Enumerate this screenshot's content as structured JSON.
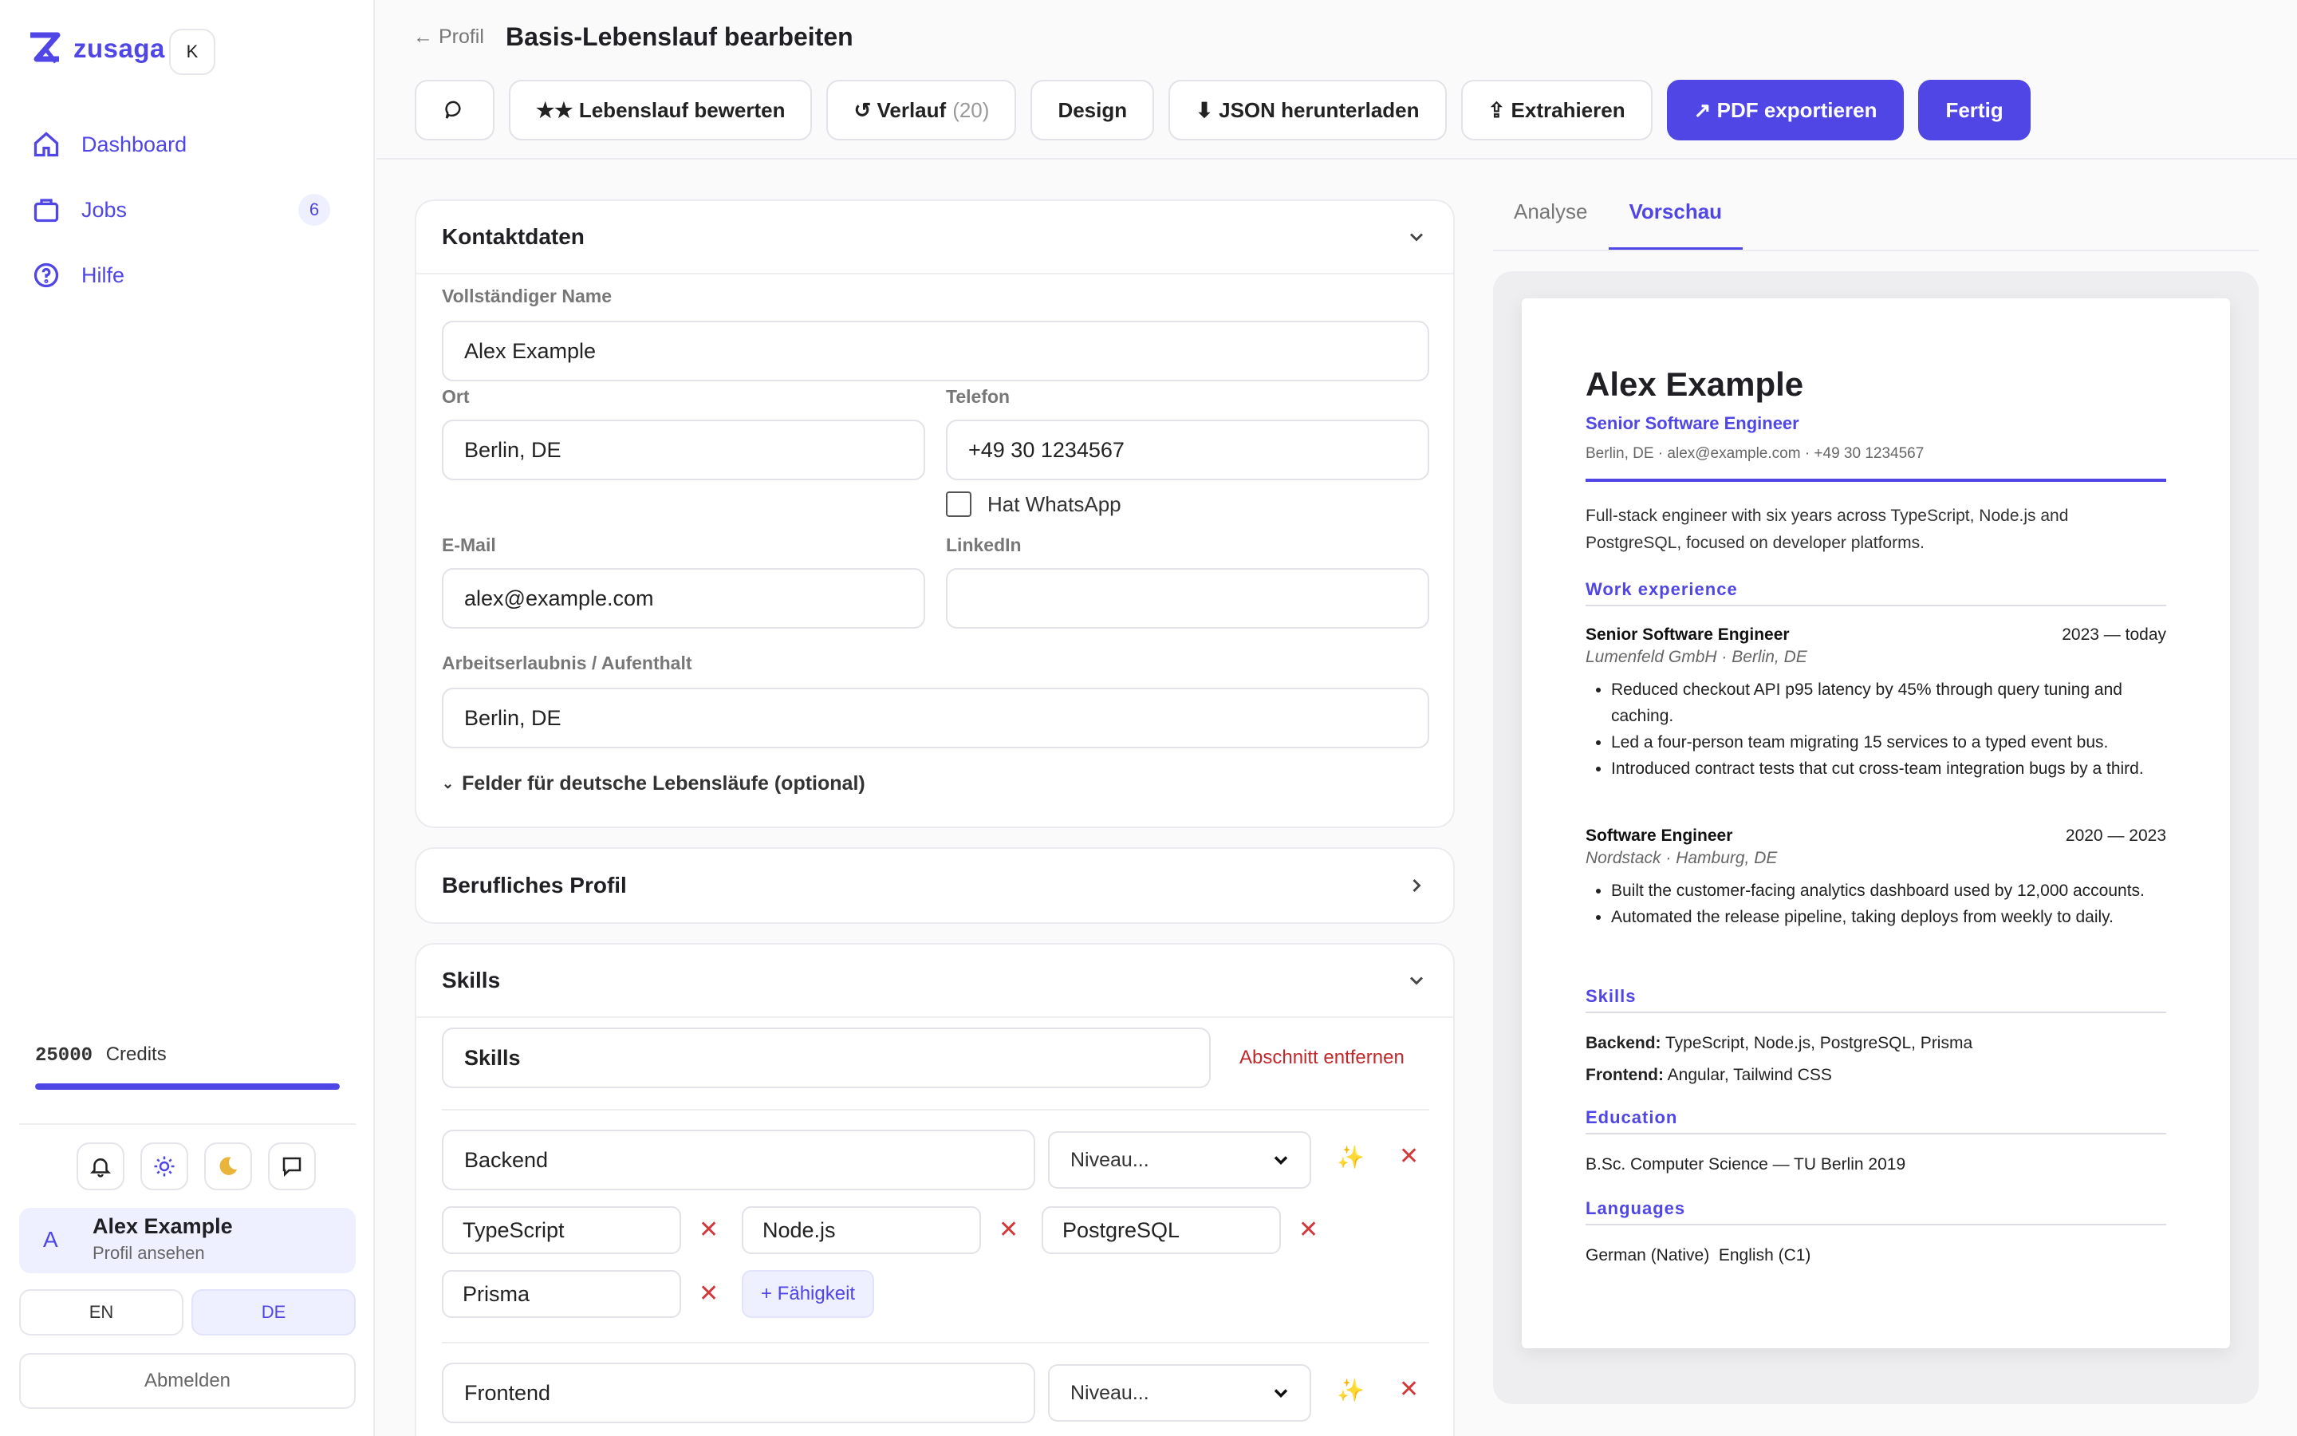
{
  "app": {
    "name": "zusaga",
    "shortcut": "K"
  },
  "sidebar": {
    "items": [
      {
        "label": "Dashboard",
        "icon": "home-icon"
      },
      {
        "label": "Jobs",
        "icon": "briefcase-icon",
        "badge": "6"
      },
      {
        "label": "Hilfe",
        "icon": "help-circle-icon"
      }
    ],
    "credits_value": "25000",
    "credits_label": "Credits",
    "credits_fill": 1.0,
    "user": {
      "initial": "A",
      "name": "Alex Example",
      "sub": "Profil ansehen"
    },
    "lang": [
      "EN",
      "DE"
    ],
    "lang_active": "DE",
    "logout": "Abmelden"
  },
  "header": {
    "back": "← Profil",
    "title": "Basis-Lebenslauf bearbeiten",
    "buttons": {
      "rate": "★★ Lebenslauf bewerten",
      "history": "↺ Verlauf",
      "history_count": "(20)",
      "design": "Design",
      "json": "⬇ JSON herunterladen",
      "extract": "⇪ Extrahieren",
      "pdf": "↗ PDF exportieren",
      "done": "Fertig"
    }
  },
  "contact": {
    "title": "Kontaktdaten",
    "name_label": "Vollständiger Name",
    "name": "Alex Example",
    "city_label": "Ort",
    "city": "Berlin, DE",
    "phone_label": "Telefon",
    "phone": "+49 30 1234567",
    "whatsapp": "Hat WhatsApp",
    "email_label": "E-Mail",
    "email": "alex@example.com",
    "linkedin_label": "LinkedIn",
    "linkedin": "",
    "permit_label": "Arbeitserlaubnis / Aufenthalt",
    "permit": "Berlin, DE",
    "german_fields": "Felder für deutsche Lebensläufe (optional)"
  },
  "profile": {
    "title": "Berufliches Profil"
  },
  "skills": {
    "title": "Skills",
    "section_name": "Skills",
    "remove": "Abschnitt entfernen",
    "groups": [
      {
        "name": "Backend",
        "level": "Niveau...",
        "items": [
          "TypeScript",
          "Node.js",
          "PostgreSQL",
          "Prisma"
        ]
      },
      {
        "name": "Frontend",
        "level": "Niveau..."
      }
    ],
    "add_skill": "+ Fähigkeit"
  },
  "tabs": [
    "Analyse",
    "Vorschau"
  ],
  "tab_active": "Vorschau",
  "preview": {
    "name": "Alex Example",
    "role": "Senior Software Engineer",
    "contact": "Berlin, DE · alex@example.com · +49 30 1234567",
    "summary": "Full-stack engineer with six years across TypeScript, Node.js and PostgreSQL, focused on developer platforms.",
    "work_heading": "Work experience",
    "jobs": [
      {
        "title": "Senior Software Engineer",
        "dates": "2023 — today",
        "company": "Lumenfeld GmbH · Berlin, DE",
        "bullets": [
          "Reduced checkout API p95 latency by 45% through query tuning and caching.",
          "Led a four-person team migrating 15 services to a typed event bus.",
          "Introduced contract tests that cut cross-team integration bugs by a third."
        ]
      },
      {
        "title": "Software Engineer",
        "dates": "2020 — 2023",
        "company": "Nordstack · Hamburg, DE",
        "bullets": [
          "Built the customer-facing analytics dashboard used by 12,000 accounts.",
          "Automated the release pipeline, taking deploys from weekly to daily."
        ]
      }
    ],
    "skills_heading": "Skills",
    "skill_lines": [
      {
        "label": "Backend:",
        "value": "TypeScript, Node.js, PostgreSQL, Prisma"
      },
      {
        "label": "Frontend:",
        "value": "Angular, Tailwind CSS"
      }
    ],
    "education_heading": "Education",
    "education": "B.Sc. Computer Science — TU Berlin 2019",
    "languages_heading": "Languages",
    "languages": "German (Native)  English (C1)"
  },
  "colors": {
    "accent": "#4f46e5",
    "danger": "#d23a3a",
    "sparkle": "#e89a2c"
  }
}
